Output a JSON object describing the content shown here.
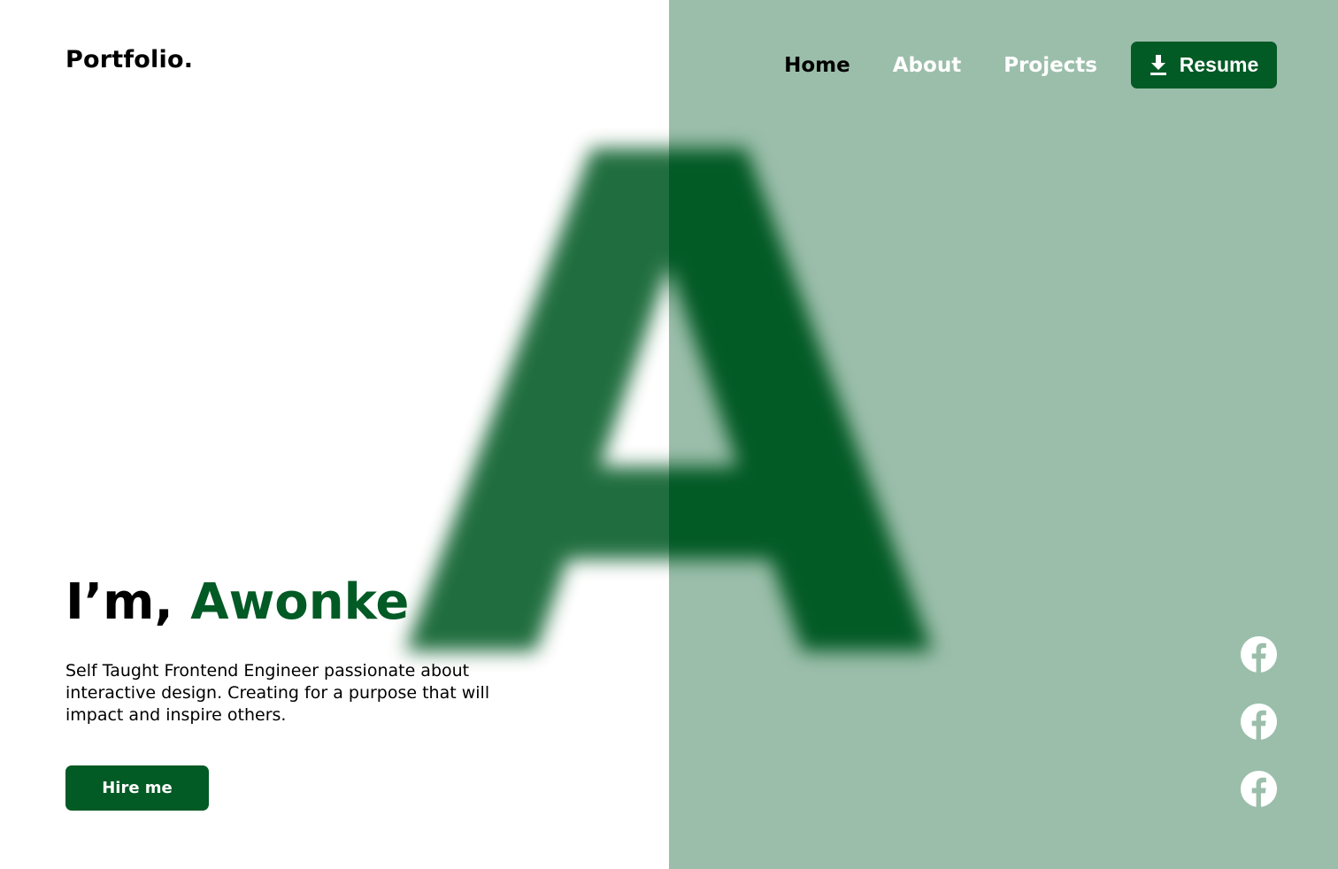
{
  "header": {
    "logo": "Portfolio.",
    "nav": [
      {
        "label": "Home",
        "active": true
      },
      {
        "label": "About",
        "active": false
      },
      {
        "label": "Projects",
        "active": false
      }
    ],
    "resume_label": "Resume",
    "resume_icon": "download-icon"
  },
  "hero": {
    "background_letter": "A",
    "greeting": "I’m,",
    "name": "Awonke",
    "description": "Self Taught Frontend Engineer passionate about interactive design.  Creating for a purpose that will impact and inspire others.",
    "hire_label": "Hire me"
  },
  "social": [
    {
      "icon": "facebook-icon"
    },
    {
      "icon": "facebook-icon"
    },
    {
      "icon": "facebook-icon"
    }
  ],
  "colors": {
    "accent": "#025a25",
    "panel": "#9bbeaa",
    "background": "#ffffff",
    "nav_inactive": "#ffffff"
  }
}
